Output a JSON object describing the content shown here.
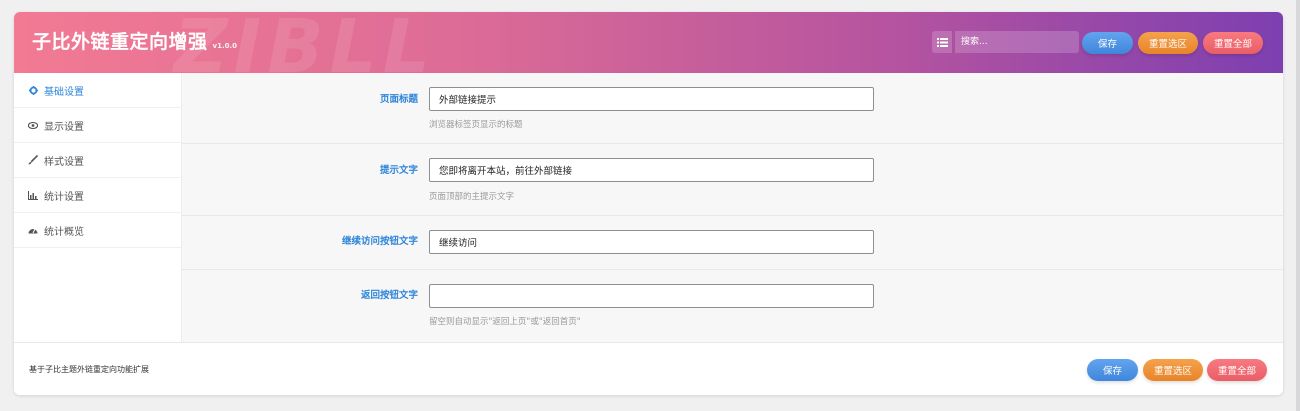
{
  "header": {
    "title": "子比外链重定向增强",
    "version": "v1.0.0",
    "watermark": "ZIBLL",
    "search_placeholder": "搜索...",
    "save_label": "保存",
    "reset_section_label": "重置选区",
    "reset_all_label": "重置全部"
  },
  "sidebar": {
    "items": [
      {
        "label": "基础设置",
        "icon": "gear-icon"
      },
      {
        "label": "显示设置",
        "icon": "eye-icon"
      },
      {
        "label": "样式设置",
        "icon": "brush-icon"
      },
      {
        "label": "统计设置",
        "icon": "bar-chart-icon"
      },
      {
        "label": "统计概览",
        "icon": "dashboard-icon"
      }
    ]
  },
  "fields": [
    {
      "label": "页面标题",
      "value": "外部链接提示",
      "description": "浏览器标签页显示的标题"
    },
    {
      "label": "提示文字",
      "value": "您即将离开本站，前往外部链接",
      "description": "页面顶部的主提示文字"
    },
    {
      "label": "继续访问按钮文字",
      "value": "继续访问",
      "description": ""
    },
    {
      "label": "返回按钮文字",
      "value": "",
      "description": "留空则自动显示\"返回上页\"或\"返回首页\""
    }
  ],
  "footer": {
    "text": "基于子比主题外链重定向功能扩展",
    "save_label": "保存",
    "reset_section_label": "重置选区",
    "reset_all_label": "重置全部"
  },
  "colors": {
    "accent": "#2f86d8",
    "header_start": "#f27a93",
    "header_end": "#7d3fb0",
    "save": "#3f86db",
    "reset_section": "#e88429",
    "reset_all": "#e95d66"
  }
}
